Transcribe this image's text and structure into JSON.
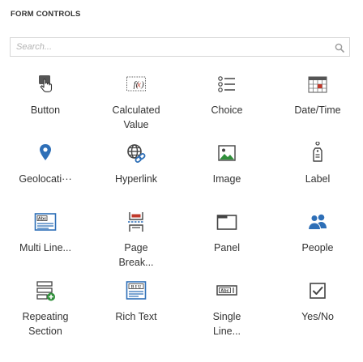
{
  "header": {
    "title": "FORM CONTROLS"
  },
  "search": {
    "placeholder": "Search...",
    "value": "",
    "icon": "search-icon"
  },
  "colors": {
    "accent_blue": "#2e6fb7",
    "accent_red": "#c0392b",
    "text": "#333333",
    "border": "#d6d6d6"
  },
  "controls": [
    {
      "label": "Button",
      "icon": "button-icon"
    },
    {
      "label": "Calculated\nValue",
      "icon": "function-icon"
    },
    {
      "label": "Choice",
      "icon": "list-icon"
    },
    {
      "label": "Date/Time",
      "icon": "calendar-icon"
    },
    {
      "label": "Geolocati···",
      "icon": "map-pin-icon"
    },
    {
      "label": "Hyperlink",
      "icon": "globe-link-icon"
    },
    {
      "label": "Image",
      "icon": "image-icon"
    },
    {
      "label": "Label",
      "icon": "tag-icon"
    },
    {
      "label": "Multi Line...",
      "icon": "multiline-text-icon"
    },
    {
      "label": "Page\nBreak...",
      "icon": "page-break-icon"
    },
    {
      "label": "Panel",
      "icon": "panel-icon"
    },
    {
      "label": "People",
      "icon": "people-icon"
    },
    {
      "label": "Repeating\nSection",
      "icon": "repeating-section-icon"
    },
    {
      "label": "Rich Text",
      "icon": "rich-text-icon"
    },
    {
      "label": "Single\nLine...",
      "icon": "single-line-text-icon"
    },
    {
      "label": "Yes/No",
      "icon": "checkbox-icon"
    }
  ]
}
